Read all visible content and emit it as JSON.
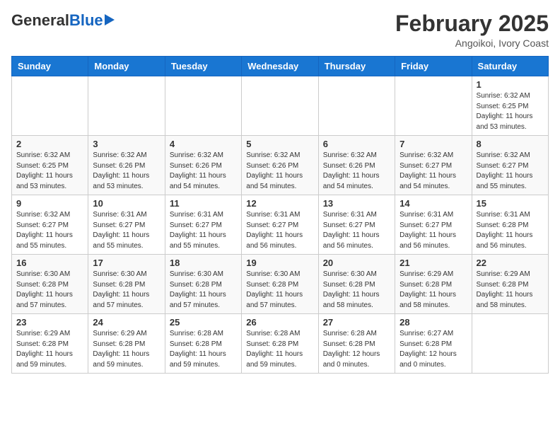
{
  "header": {
    "logo_general": "General",
    "logo_blue": "Blue",
    "month_title": "February 2025",
    "location": "Angoikoi, Ivory Coast"
  },
  "weekdays": [
    "Sunday",
    "Monday",
    "Tuesday",
    "Wednesday",
    "Thursday",
    "Friday",
    "Saturday"
  ],
  "weeks": [
    [
      {
        "day": "",
        "info": ""
      },
      {
        "day": "",
        "info": ""
      },
      {
        "day": "",
        "info": ""
      },
      {
        "day": "",
        "info": ""
      },
      {
        "day": "",
        "info": ""
      },
      {
        "day": "",
        "info": ""
      },
      {
        "day": "1",
        "info": "Sunrise: 6:32 AM\nSunset: 6:25 PM\nDaylight: 11 hours\nand 53 minutes."
      }
    ],
    [
      {
        "day": "2",
        "info": "Sunrise: 6:32 AM\nSunset: 6:25 PM\nDaylight: 11 hours\nand 53 minutes."
      },
      {
        "day": "3",
        "info": "Sunrise: 6:32 AM\nSunset: 6:26 PM\nDaylight: 11 hours\nand 53 minutes."
      },
      {
        "day": "4",
        "info": "Sunrise: 6:32 AM\nSunset: 6:26 PM\nDaylight: 11 hours\nand 54 minutes."
      },
      {
        "day": "5",
        "info": "Sunrise: 6:32 AM\nSunset: 6:26 PM\nDaylight: 11 hours\nand 54 minutes."
      },
      {
        "day": "6",
        "info": "Sunrise: 6:32 AM\nSunset: 6:26 PM\nDaylight: 11 hours\nand 54 minutes."
      },
      {
        "day": "7",
        "info": "Sunrise: 6:32 AM\nSunset: 6:27 PM\nDaylight: 11 hours\nand 54 minutes."
      },
      {
        "day": "8",
        "info": "Sunrise: 6:32 AM\nSunset: 6:27 PM\nDaylight: 11 hours\nand 55 minutes."
      }
    ],
    [
      {
        "day": "9",
        "info": "Sunrise: 6:32 AM\nSunset: 6:27 PM\nDaylight: 11 hours\nand 55 minutes."
      },
      {
        "day": "10",
        "info": "Sunrise: 6:31 AM\nSunset: 6:27 PM\nDaylight: 11 hours\nand 55 minutes."
      },
      {
        "day": "11",
        "info": "Sunrise: 6:31 AM\nSunset: 6:27 PM\nDaylight: 11 hours\nand 55 minutes."
      },
      {
        "day": "12",
        "info": "Sunrise: 6:31 AM\nSunset: 6:27 PM\nDaylight: 11 hours\nand 56 minutes."
      },
      {
        "day": "13",
        "info": "Sunrise: 6:31 AM\nSunset: 6:27 PM\nDaylight: 11 hours\nand 56 minutes."
      },
      {
        "day": "14",
        "info": "Sunrise: 6:31 AM\nSunset: 6:27 PM\nDaylight: 11 hours\nand 56 minutes."
      },
      {
        "day": "15",
        "info": "Sunrise: 6:31 AM\nSunset: 6:28 PM\nDaylight: 11 hours\nand 56 minutes."
      }
    ],
    [
      {
        "day": "16",
        "info": "Sunrise: 6:30 AM\nSunset: 6:28 PM\nDaylight: 11 hours\nand 57 minutes."
      },
      {
        "day": "17",
        "info": "Sunrise: 6:30 AM\nSunset: 6:28 PM\nDaylight: 11 hours\nand 57 minutes."
      },
      {
        "day": "18",
        "info": "Sunrise: 6:30 AM\nSunset: 6:28 PM\nDaylight: 11 hours\nand 57 minutes."
      },
      {
        "day": "19",
        "info": "Sunrise: 6:30 AM\nSunset: 6:28 PM\nDaylight: 11 hours\nand 57 minutes."
      },
      {
        "day": "20",
        "info": "Sunrise: 6:30 AM\nSunset: 6:28 PM\nDaylight: 11 hours\nand 58 minutes."
      },
      {
        "day": "21",
        "info": "Sunrise: 6:29 AM\nSunset: 6:28 PM\nDaylight: 11 hours\nand 58 minutes."
      },
      {
        "day": "22",
        "info": "Sunrise: 6:29 AM\nSunset: 6:28 PM\nDaylight: 11 hours\nand 58 minutes."
      }
    ],
    [
      {
        "day": "23",
        "info": "Sunrise: 6:29 AM\nSunset: 6:28 PM\nDaylight: 11 hours\nand 59 minutes."
      },
      {
        "day": "24",
        "info": "Sunrise: 6:29 AM\nSunset: 6:28 PM\nDaylight: 11 hours\nand 59 minutes."
      },
      {
        "day": "25",
        "info": "Sunrise: 6:28 AM\nSunset: 6:28 PM\nDaylight: 11 hours\nand 59 minutes."
      },
      {
        "day": "26",
        "info": "Sunrise: 6:28 AM\nSunset: 6:28 PM\nDaylight: 11 hours\nand 59 minutes."
      },
      {
        "day": "27",
        "info": "Sunrise: 6:28 AM\nSunset: 6:28 PM\nDaylight: 12 hours\nand 0 minutes."
      },
      {
        "day": "28",
        "info": "Sunrise: 6:27 AM\nSunset: 6:28 PM\nDaylight: 12 hours\nand 0 minutes."
      },
      {
        "day": "",
        "info": ""
      }
    ]
  ]
}
